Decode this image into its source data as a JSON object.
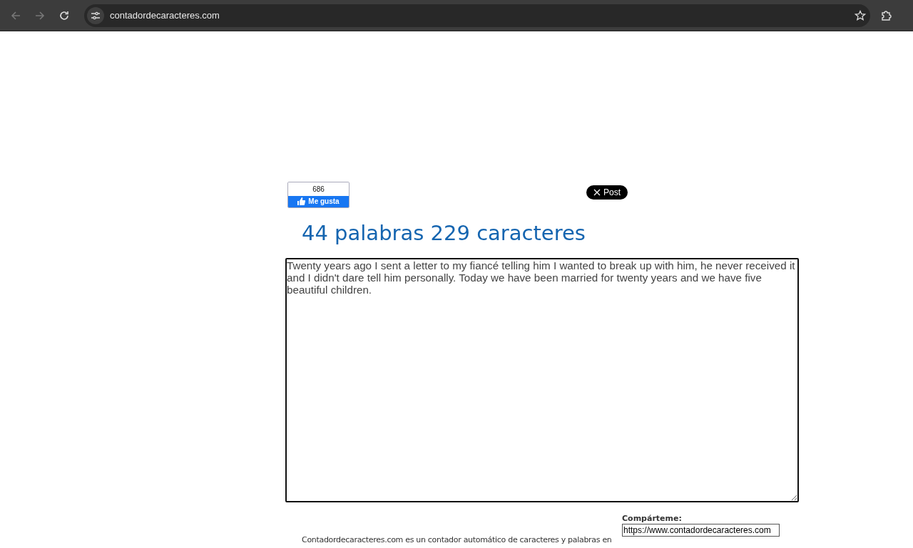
{
  "browser": {
    "url": "contadordecaracteres.com"
  },
  "social": {
    "like_count": "686",
    "like_label": "Me gusta",
    "post_label": "Post"
  },
  "heading": "44 palabras 229 caracteres",
  "text_area": {
    "value": "Twenty years ago I sent a letter to my fiancé telling him I wanted to break up with him, he never received it and I didn't dare tell him personally. Today we have been married for twenty years and we have five beautiful children."
  },
  "share": {
    "label": "Compárteme:",
    "value": "https://www.contadordecaracteres.com"
  },
  "description": "Contadordecaracteres.com es un contador automático de caracteres y palabras en"
}
